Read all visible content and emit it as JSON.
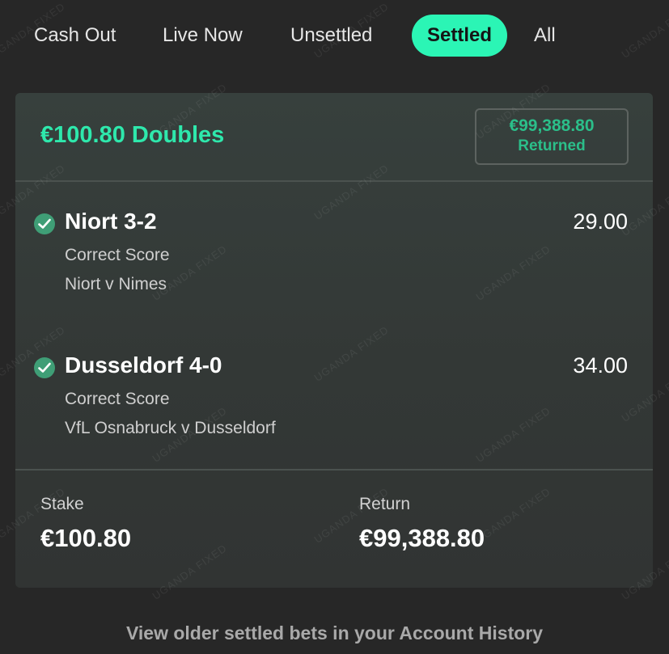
{
  "tabs": [
    {
      "label": "Cash Out",
      "active": false
    },
    {
      "label": "Live Now",
      "active": false
    },
    {
      "label": "Unsettled",
      "active": false
    },
    {
      "label": "Settled",
      "active": true
    },
    {
      "label": "All",
      "active": false
    }
  ],
  "bet": {
    "title": "€100.80 Doubles",
    "returned_amount": "€99,388.80",
    "returned_label": "Returned",
    "selections": [
      {
        "name": "Niort 3-2",
        "odds": "29.00",
        "market": "Correct Score",
        "event": "Niort v Nimes",
        "status_icon": "check-circle-icon"
      },
      {
        "name": "Dusseldorf 4-0",
        "odds": "34.00",
        "market": "Correct Score",
        "event": "VfL Osnabruck v Dusseldorf",
        "status_icon": "check-circle-icon"
      }
    ],
    "stake_label": "Stake",
    "stake_value": "€100.80",
    "return_label": "Return",
    "return_value": "€99,388.80"
  },
  "footer": {
    "history_link": "View older settled bets in your Account History"
  },
  "watermark_text": "UGANDA FIXED",
  "colors": {
    "accent": "#2bf5b5",
    "title": "#2ee8ac",
    "returned": "#2bbf8a",
    "check": "#3f9e76",
    "background": "#272727",
    "card": "#353b39"
  }
}
